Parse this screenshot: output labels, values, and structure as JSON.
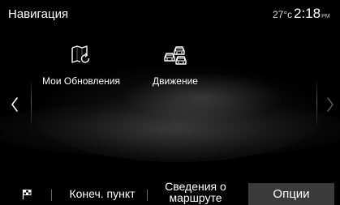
{
  "header": {
    "title": "Навигация",
    "temperature": "27°c",
    "time": "2:18",
    "ampm": "PM"
  },
  "tiles": [
    {
      "label": "Мои Обновления",
      "icon": "map-refresh-icon"
    },
    {
      "label": "Движение",
      "icon": "traffic-icon"
    }
  ],
  "nav": {
    "prev_icon": "chevron-left-icon",
    "next_icon": "chevron-right-icon"
  },
  "bottom_bar": {
    "flag_icon": "checkered-flag-icon",
    "destination_label": "Конеч. пункт",
    "route_info_label": "Сведения о маршруте",
    "options_label": "Опции"
  },
  "colors": {
    "background": "#000000",
    "text": "#ffffff",
    "options_tab_bg": "#3a3a3a"
  }
}
